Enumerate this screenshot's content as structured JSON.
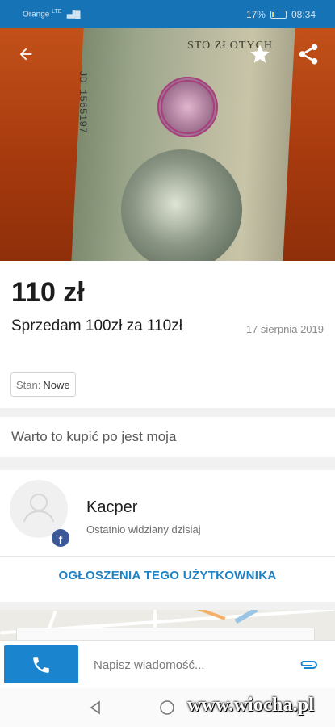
{
  "status_bar": {
    "carrier": "Orange",
    "network": "LTE",
    "battery_percent": "17%",
    "battery_level": 0.17,
    "time": "08:34"
  },
  "hero": {
    "back_icon": "arrow-left-icon",
    "favorite_icon": "star-icon",
    "share_icon": "share-icon",
    "banknote_text": "STO ZŁOTYCH",
    "banknote_serial": "JD 1565197",
    "colors": {
      "accent": "#1673b6"
    }
  },
  "listing": {
    "price": "110 zł",
    "title": "Sprzedam 100zł za 110zł",
    "date": "17 sierpnia 2019",
    "condition_label": "Stan:",
    "condition_value": "Nowe",
    "description": "Warto to kupić po jest moja"
  },
  "seller": {
    "name": "Kacper",
    "last_seen": "Ostatnio widziany dzisiaj",
    "badge_icon": "facebook-icon",
    "badge_letter": "f",
    "user_ads_label": "OGŁOSZENIA TEGO UŻYTKOWNIKA"
  },
  "bottom_bar": {
    "call_icon": "phone-icon",
    "message_placeholder": "Napisz wiadomość...",
    "attach_icon": "paperclip-icon"
  },
  "watermark": "www.wiocha.pl"
}
